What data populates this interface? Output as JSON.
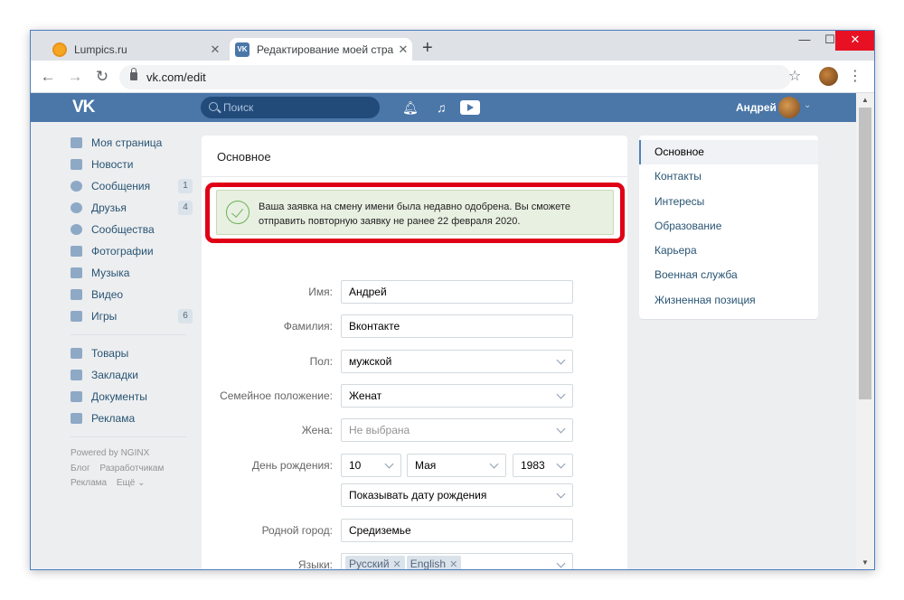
{
  "browser": {
    "tabs": [
      {
        "title": "Lumpics.ru",
        "active": false
      },
      {
        "title": "Редактирование моей страниц",
        "active": true
      }
    ],
    "url": "vk.com/edit"
  },
  "vk": {
    "logo": "VK",
    "search_placeholder": "Поиск",
    "user_name": "Андрей",
    "brand_color": "#4a76a8"
  },
  "leftnav": {
    "items": [
      {
        "label": "Моя страница",
        "icon": "home-icon",
        "badge": ""
      },
      {
        "label": "Новости",
        "icon": "news-icon",
        "badge": ""
      },
      {
        "label": "Сообщения",
        "icon": "messages-icon",
        "badge": "1"
      },
      {
        "label": "Друзья",
        "icon": "friends-icon",
        "badge": "4"
      },
      {
        "label": "Сообщества",
        "icon": "communities-icon",
        "badge": ""
      },
      {
        "label": "Фотографии",
        "icon": "camera-icon",
        "badge": ""
      },
      {
        "label": "Музыка",
        "icon": "music-icon",
        "badge": ""
      },
      {
        "label": "Видео",
        "icon": "video-icon",
        "badge": ""
      },
      {
        "label": "Игры",
        "icon": "gamepad-icon",
        "badge": "6"
      }
    ],
    "items2": [
      {
        "label": "Товары",
        "icon": "bag-icon"
      },
      {
        "label": "Закладки",
        "icon": "star-icon"
      },
      {
        "label": "Документы",
        "icon": "document-icon"
      },
      {
        "label": "Реклама",
        "icon": "megaphone-icon"
      }
    ],
    "powered": "Powered by NGINX",
    "footer": [
      "Блог",
      "Разработчикам",
      "Реклама",
      "Ещё ⌄"
    ]
  },
  "main": {
    "title": "Основное",
    "notice": "Ваша заявка на смену имени была недавно одобрена. Вы сможете отправить повторную заявку не ранее 22 февраля 2020.",
    "fields": {
      "first_name_label": "Имя:",
      "first_name": "Андрей",
      "last_name_label": "Фамилия:",
      "last_name": "Вконтакте",
      "gender_label": "Пол:",
      "gender": "мужской",
      "marital_label": "Семейное положение:",
      "marital": "Женат",
      "spouse_label": "Жена:",
      "spouse": "Не выбрана",
      "birthday_label": "День рождения:",
      "birth_day": "10",
      "birth_month": "Мая",
      "birth_year": "1983",
      "birthday_visibility": "Показывать дату рождения",
      "hometown_label": "Родной город:",
      "hometown": "Средиземье",
      "languages_label": "Языки:",
      "languages": [
        "Русский",
        "English"
      ]
    }
  },
  "rightmenu": {
    "items": [
      "Основное",
      "Контакты",
      "Интересы",
      "Образование",
      "Карьера",
      "Военная служба",
      "Жизненная позиция"
    ]
  }
}
